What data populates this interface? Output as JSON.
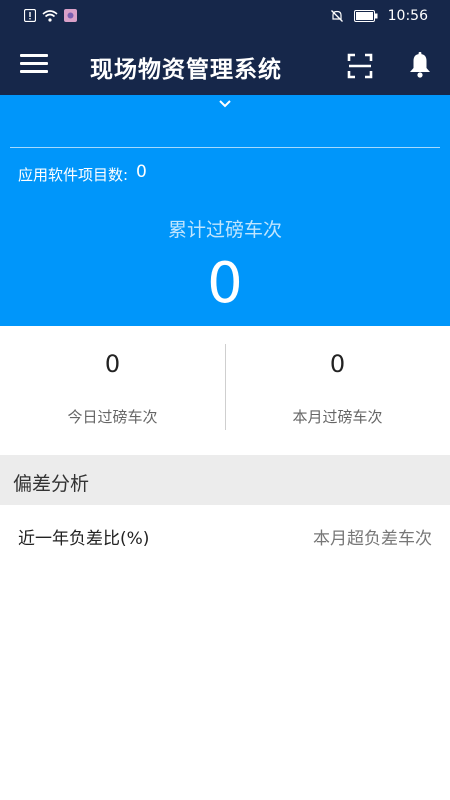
{
  "status_bar": {
    "time": "10:56",
    "icons": [
      "alert-icon",
      "wifi-icon",
      "app-notification-icon",
      "mute-icon",
      "battery-icon"
    ]
  },
  "app_bar": {
    "title": "现场物资管理系统",
    "icons": [
      "menu-icon",
      "scan-icon",
      "bell-icon"
    ]
  },
  "hero": {
    "project_count_label": "应用软件项目数:",
    "project_count_value": "0",
    "total_label": "累计过磅车次",
    "total_value": "0"
  },
  "stats": [
    {
      "value": "0",
      "label": "今日过磅车次"
    },
    {
      "value": "0",
      "label": "本月过磅车次"
    }
  ],
  "deviation": {
    "section_title": "偏差分析",
    "left_label": "近一年负差比(%)",
    "right_label": "本月超负差车次"
  },
  "colors": {
    "header_bg": "#16274a",
    "hero_bg": "#0096fa",
    "section_bg": "#ececec"
  }
}
